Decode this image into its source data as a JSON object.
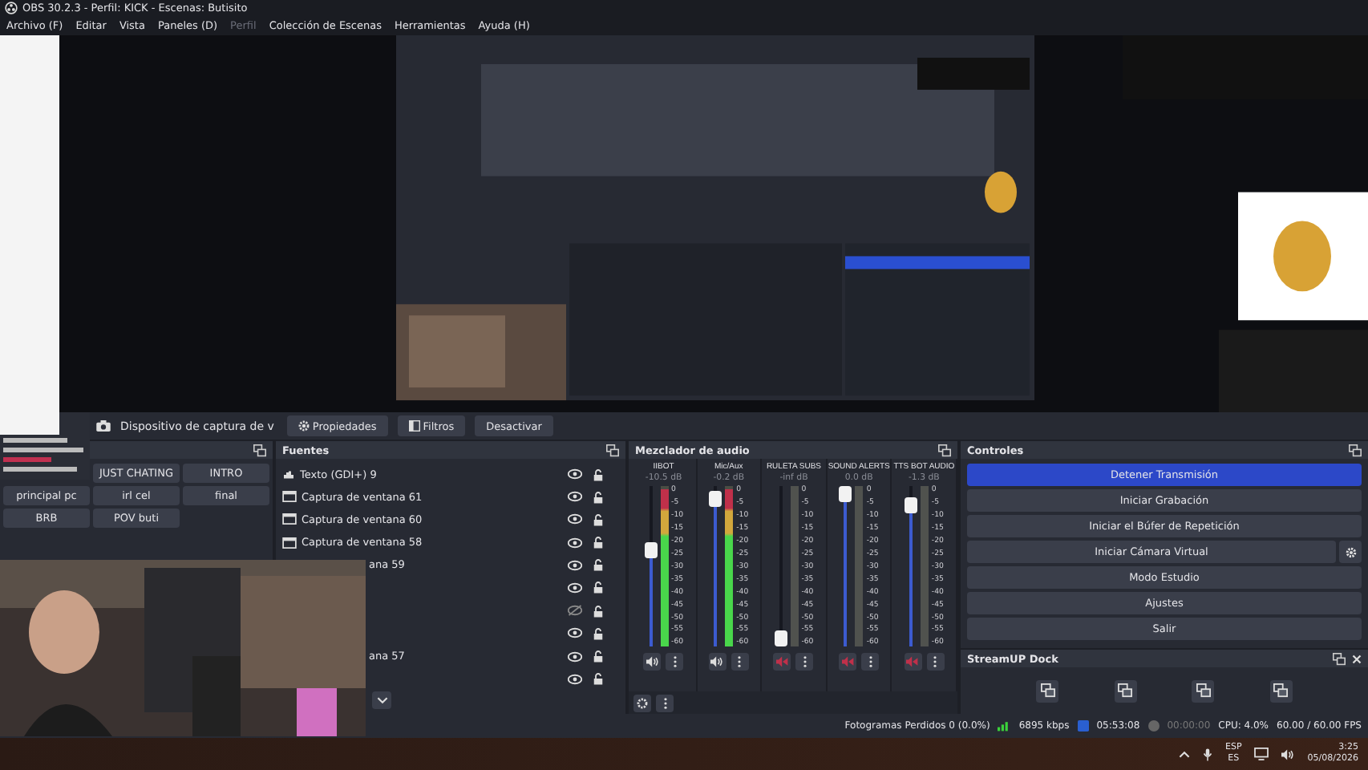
{
  "window": {
    "title": "OBS 30.2.3 - Perfil: KICK - Escenas: Butisito"
  },
  "menu": [
    {
      "label": "Archivo (F)",
      "disabled": false
    },
    {
      "label": "Editar",
      "disabled": false
    },
    {
      "label": "Vista",
      "disabled": false
    },
    {
      "label": "Paneles (D)",
      "disabled": false
    },
    {
      "label": "Perfil",
      "disabled": true
    },
    {
      "label": "Colección de Escenas",
      "disabled": false
    },
    {
      "label": "Herramientas",
      "disabled": false
    },
    {
      "label": "Ayuda (H)",
      "disabled": false
    }
  ],
  "source_toolbar": {
    "source": "Dispositivo de captura de v",
    "buttons": [
      {
        "label": "Propiedades"
      },
      {
        "label": "Filtros"
      },
      {
        "label": "Desactivar"
      }
    ]
  },
  "scenes": {
    "items": [
      {
        "label": "JUST CHATING"
      },
      {
        "label": "INTRO"
      },
      {
        "label": "principal pc"
      },
      {
        "label": "irl cel"
      },
      {
        "label": "final"
      },
      {
        "label": "BRB"
      },
      {
        "label": "POV buti"
      }
    ]
  },
  "sources": {
    "title": "Fuentes",
    "items": [
      {
        "kind": "text",
        "name": "Texto (GDI+) 9",
        "visible": true
      },
      {
        "kind": "window",
        "name": "Captura de ventana 61",
        "visible": true
      },
      {
        "kind": "window",
        "name": "Captura de ventana 60",
        "visible": true
      },
      {
        "kind": "window",
        "name": "Captura de ventana 58",
        "visible": true
      },
      {
        "kind": "cut",
        "name": "ana 59",
        "visible": true
      },
      {
        "kind": "covered",
        "visible": true
      },
      {
        "kind": "covered",
        "visible": false
      },
      {
        "kind": "covered",
        "visible": true
      },
      {
        "kind": "cut",
        "name": "ana 57",
        "visible": true
      },
      {
        "kind": "covered",
        "visible": true
      }
    ]
  },
  "mixer": {
    "title": "Mezclador de audio",
    "channels": [
      {
        "name": "IIBOT",
        "reading": "-10.5 dB",
        "level": 0.62,
        "muted": false,
        "meter": {
          "level": 0.98
        },
        "scale": [
          "0",
          "-5",
          "-10",
          "-15",
          "-20",
          "-25",
          "-30",
          "-35",
          "-40",
          "-45",
          "-50",
          "-55",
          "-60"
        ]
      },
      {
        "name": "Mic/Aux",
        "reading": "-0.2 dB",
        "level": 0.97,
        "muted": false,
        "meter": {
          "level": 0.98
        },
        "scale": [
          "0",
          "-5",
          "-10",
          "-15",
          "-20",
          "-25",
          "-30",
          "-35",
          "-40",
          "-45",
          "-50",
          "-55",
          "-60"
        ]
      },
      {
        "name": "RULETA SUBS",
        "reading": "-inf dB",
        "level": 0.0,
        "muted": true,
        "scale": [
          "0",
          "-5",
          "-10",
          "-15",
          "-20",
          "-25",
          "-30",
          "-35",
          "-40",
          "-45",
          "-50",
          "-55",
          "-60"
        ]
      },
      {
        "name": "SOUND ALERTS",
        "reading": "0.0 dB",
        "level": 1.0,
        "muted": true,
        "scale": [
          "0",
          "-5",
          "-10",
          "-15",
          "-20",
          "-25",
          "-30",
          "-35",
          "-40",
          "-45",
          "-50",
          "-55",
          "-60"
        ]
      },
      {
        "name": "TTS BOT AUDIO",
        "reading": "-1.3 dB",
        "level": 0.93,
        "muted": true,
        "scale": [
          "0",
          "-5",
          "-10",
          "-15",
          "-20",
          "-25",
          "-30",
          "-35",
          "-40",
          "-45",
          "-50",
          "-55",
          "-60"
        ]
      }
    ]
  },
  "controls": {
    "title": "Controles",
    "buttons": [
      {
        "label": "Detener Transmisión",
        "active": true,
        "settings": false
      },
      {
        "label": "Iniciar Grabación",
        "active": false,
        "settings": false
      },
      {
        "label": "Iniciar el Búfer de Repetición",
        "active": false,
        "settings": false
      },
      {
        "label": "Iniciar Cámara Virtual",
        "active": false,
        "settings": true
      },
      {
        "label": "Modo Estudio",
        "active": false,
        "settings": false
      },
      {
        "label": "Ajustes",
        "active": false,
        "settings": false
      },
      {
        "label": "Salir",
        "active": false,
        "settings": false
      }
    ]
  },
  "streamup": {
    "title": "StreamUP Dock"
  },
  "status_bar": {
    "dropped": "Fotogramas Perdidos 0 (0.0%)",
    "bitrate": "6895 kbps",
    "stream_time": "05:53:08",
    "record_time": "00:00:00",
    "cpu": "CPU: 4.0%",
    "fps": "60.00 / 60.00 FPS"
  },
  "taskbar": {
    "lang_top": "ESP",
    "lang_bottom": "ES",
    "time": "3:25",
    "date": "05/08/2026"
  }
}
